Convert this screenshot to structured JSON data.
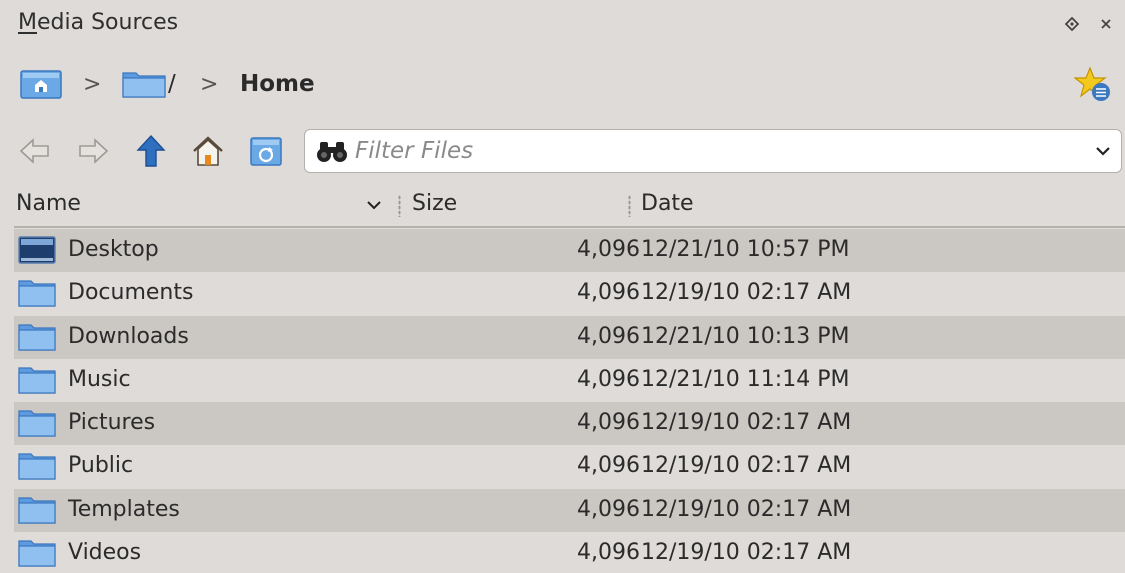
{
  "window": {
    "title_first": "M",
    "title_rest": "edia Sources"
  },
  "breadcrumb": {
    "root": "/",
    "current": "Home",
    "separator": ">"
  },
  "toolbar": {
    "filter_placeholder": "Filter Files"
  },
  "table": {
    "columns": [
      "Name",
      "Size",
      "Date"
    ],
    "sort_indicator": "chevron-down",
    "rows": [
      {
        "name": "Desktop",
        "size": "4,096",
        "date": "12/21/10 10:57 PM",
        "icon": "desktop-icon"
      },
      {
        "name": "Documents",
        "size": "4,096",
        "date": "12/19/10 02:17 AM",
        "icon": "folder-icon"
      },
      {
        "name": "Downloads",
        "size": "4,096",
        "date": "12/21/10 10:13 PM",
        "icon": "folder-icon"
      },
      {
        "name": "Music",
        "size": "4,096",
        "date": "12/21/10 11:14 PM",
        "icon": "folder-icon"
      },
      {
        "name": "Pictures",
        "size": "4,096",
        "date": "12/19/10 02:17 AM",
        "icon": "folder-icon"
      },
      {
        "name": "Public",
        "size": "4,096",
        "date": "12/19/10 02:17 AM",
        "icon": "folder-icon"
      },
      {
        "name": "Templates",
        "size": "4,096",
        "date": "12/19/10 02:17 AM",
        "icon": "folder-icon"
      },
      {
        "name": "Videos",
        "size": "4,096",
        "date": "12/19/10 02:17 AM",
        "icon": "folder-icon"
      }
    ]
  },
  "colors": {
    "background": "#dedbd8",
    "row_alt": "#cbc7c3",
    "folder_blue": "#6aa8e6",
    "arrow_blue": "#2f6fc0"
  }
}
